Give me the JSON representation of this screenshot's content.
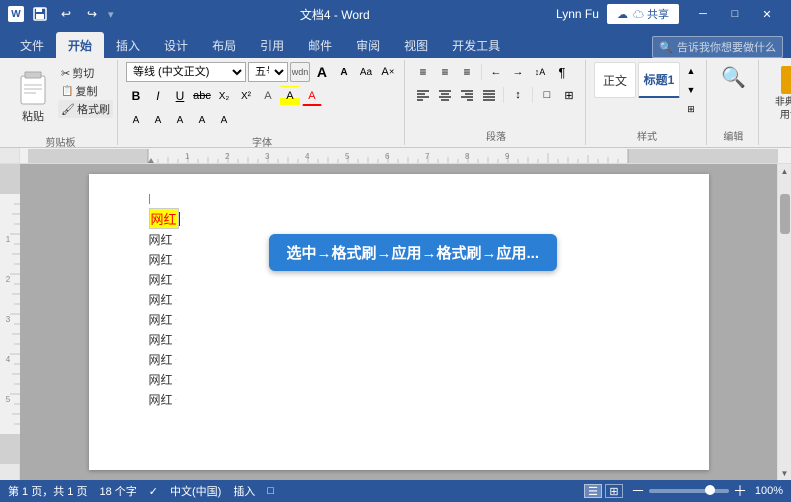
{
  "titlebar": {
    "title": "文档4 - Word",
    "user": "Lynn Fu",
    "share_label": "☁ 共享",
    "minimize": "─",
    "restore": "□",
    "close": "✕"
  },
  "quickaccess": {
    "save_label": "💾",
    "undo_label": "↩",
    "redo_label": "↪",
    "separator": "|"
  },
  "tabs": [
    {
      "label": "文件",
      "active": false
    },
    {
      "label": "开始",
      "active": true
    },
    {
      "label": "插入",
      "active": false
    },
    {
      "label": "设计",
      "active": false
    },
    {
      "label": "布局",
      "active": false
    },
    {
      "label": "引用",
      "active": false
    },
    {
      "label": "邮件",
      "active": false
    },
    {
      "label": "审阅",
      "active": false
    },
    {
      "label": "视图",
      "active": false
    },
    {
      "label": "开发工具",
      "active": false
    }
  ],
  "ribbon": {
    "clipboard": {
      "label": "剪贴板",
      "paste": "粘贴",
      "cut": "✂ 剪切",
      "copy": "📋 复制",
      "format_painter": "🖌 格式刷"
    },
    "font": {
      "label": "字体",
      "font_name": "等线 (中文正文)",
      "font_size": "五号",
      "wdn": "wdn",
      "A_large": "A",
      "B": "B",
      "I": "I",
      "U": "U",
      "strike": "abc",
      "sub": "X₂",
      "sup": "X²",
      "clear": "A",
      "highlight": "A",
      "color": "A",
      "change_case": "Aa",
      "shrink": "A",
      "grow": "A",
      "char_spacing": "A"
    },
    "paragraph": {
      "label": "段落",
      "bullet": "≡",
      "numbered": "≡",
      "multi_level": "≡",
      "decrease_indent": "←",
      "increase_indent": "→",
      "sort": "↕A",
      "show_marks": "¶",
      "align_left": "≡",
      "align_center": "≡",
      "align_right": "≡",
      "justify": "≡",
      "line_spacing": "↕",
      "shading": "□",
      "borders": "⊞"
    },
    "styles": {
      "label": "样式",
      "normal": "正文",
      "heading1": "标题1"
    },
    "editing": {
      "label": "编辑",
      "icon": "🔍"
    },
    "nonstandard": {
      "label": "非典型常\n用命令"
    }
  },
  "search": {
    "placeholder": "告诉我你想要做什么"
  },
  "document": {
    "lines": [
      "网红·",
      "网红·",
      "网红·",
      "网红·",
      "网红·",
      "网红·",
      "网红·",
      "网红·",
      "网红·"
    ],
    "first_line": "网红",
    "tooltip": "选中→格式刷→应用→格式刷→应用..."
  },
  "statusbar": {
    "page": "第 1 页，共 1 页",
    "words": "18 个字",
    "language": "中文(中国)",
    "insert": "插入",
    "save_indicator": "□",
    "zoom": "100%",
    "zoom_level": 70
  }
}
